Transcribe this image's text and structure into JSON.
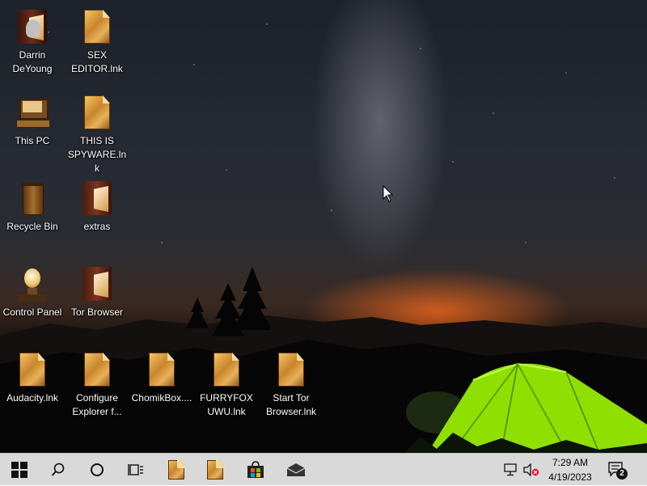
{
  "desktop": {
    "icons": [
      {
        "label": "Darrin DeYoung",
        "icon": "user-folder-icon"
      },
      {
        "label": "SEX EDITOR.lnk",
        "icon": "file-shortcut-icon"
      },
      {
        "label": "This PC",
        "icon": "computer-icon"
      },
      {
        "label": "THIS IS SPYWARE.lnk",
        "icon": "file-shortcut-icon"
      },
      {
        "label": "Recycle Bin",
        "icon": "recycle-bin-icon"
      },
      {
        "label": "extras",
        "icon": "folder-icon"
      },
      {
        "label": "Control Panel",
        "icon": "control-panel-icon"
      },
      {
        "label": "Tor Browser",
        "icon": "folder-icon"
      },
      {
        "label": "Audacity.lnk",
        "icon": "file-shortcut-icon"
      },
      {
        "label": "Configure Explorer f...",
        "icon": "file-shortcut-icon"
      },
      {
        "label": "ChomikBox....",
        "icon": "file-shortcut-icon"
      },
      {
        "label": "FURRYFOX UWU.lnk",
        "icon": "file-shortcut-icon"
      },
      {
        "label": "Start Tor Browser.lnk",
        "icon": "file-shortcut-icon"
      }
    ]
  },
  "taskbar": {
    "start_icon": "windows-logo-icon",
    "search_icon": "search-icon",
    "cortana_icon": "cortana-circle-icon",
    "task_view_icon": "task-view-icon",
    "pinned": [
      "file-icon",
      "file-icon",
      "store-icon",
      "mail-icon"
    ],
    "tray": {
      "network_icon": "network-icon",
      "volume_icon": "volume-muted-icon",
      "time": "7:29 AM",
      "date": "4/19/2023",
      "notifications_count": "2"
    }
  },
  "colors": {
    "taskbar_bg": "#d9d9d9",
    "tent": "#8fe000",
    "glow": "#ff6a1a",
    "muted_red": "#e81123"
  }
}
